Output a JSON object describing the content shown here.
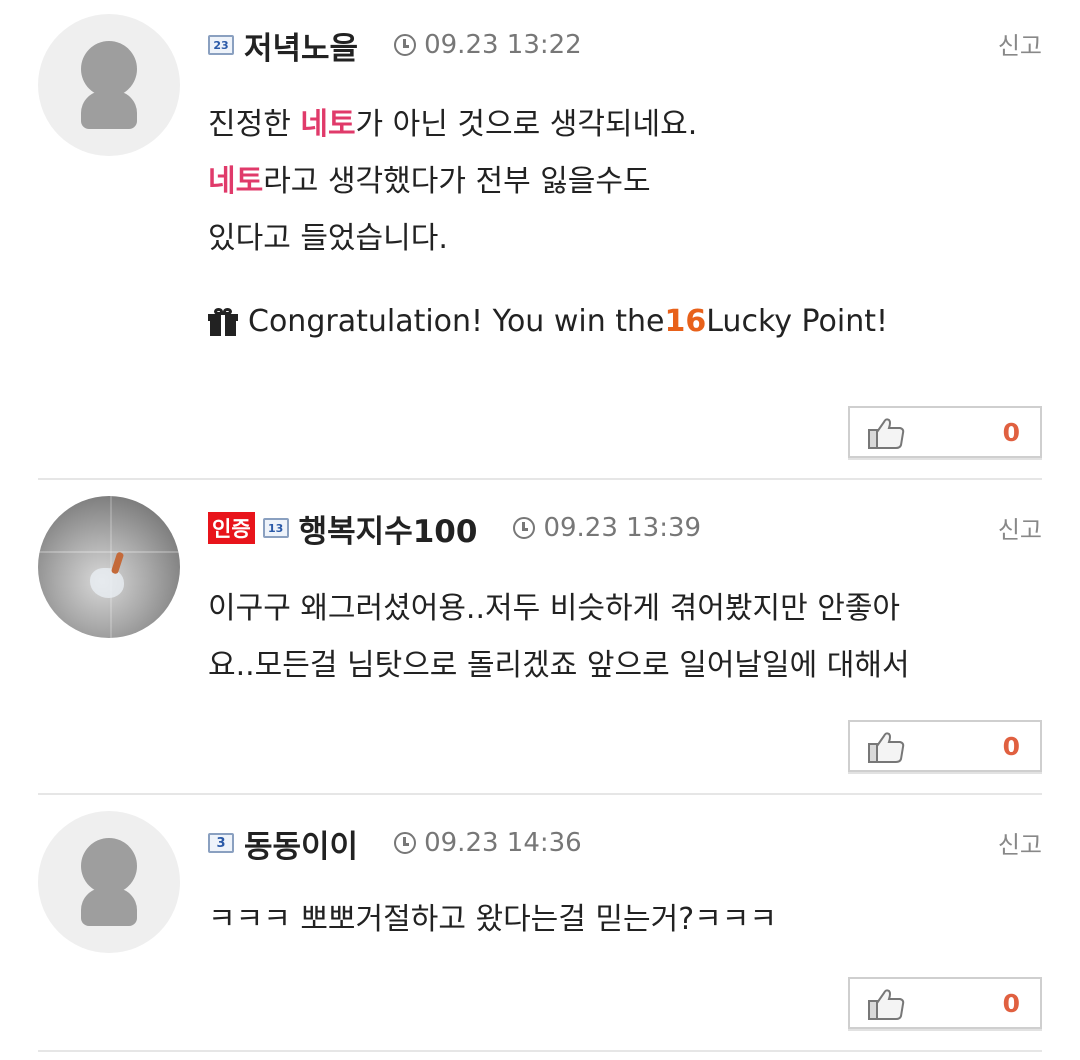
{
  "report_label": "신고",
  "comments": [
    {
      "level": "23",
      "nickname": "저녁노을",
      "time": "09.23 13:22",
      "lines": [
        {
          "hl": "",
          "text": "진정한 ",
          "hl2": "네토",
          "rest": "가 아닌 것으로 생각되네요."
        },
        {
          "hl": "네토",
          "text": "라고 생각했다가 전부 잃을수도",
          "hl2": "",
          "rest": ""
        },
        {
          "hl": "",
          "text": "있다고 들었습니다.",
          "hl2": "",
          "rest": ""
        }
      ],
      "lucky": {
        "before": "Congratulation! You win the ",
        "points": "16",
        "after": " Lucky Point!"
      },
      "likes": "0"
    },
    {
      "cert_badge": "인증",
      "level": "13",
      "nickname": "행복지수100",
      "time": "09.23 13:39",
      "lines": [
        {
          "text": "이구구 왜그러셨어용..저두 비슷하게 겪어봤지만 안좋아"
        },
        {
          "text": "요..모든걸 님탓으로 돌리겠죠 앞으로 일어날일에 대해서"
        }
      ],
      "likes": "0"
    },
    {
      "level": "3",
      "nickname": "동동이이",
      "time": "09.23 14:36",
      "lines": [
        {
          "text": "ㅋㅋㅋ 뽀뽀거절하고 왔다는걸 믿는거?ㅋㅋㅋ"
        }
      ],
      "likes": "0"
    }
  ],
  "colors": {
    "highlight": "#e03a6a",
    "points": "#e8611a",
    "cert": "#e8141b",
    "like_count": "#e06040"
  },
  "icons": {
    "clock": "clock-icon",
    "gift": "gift-icon",
    "thumb": "thumbs-up-icon",
    "avatar": "default-avatar-icon"
  }
}
